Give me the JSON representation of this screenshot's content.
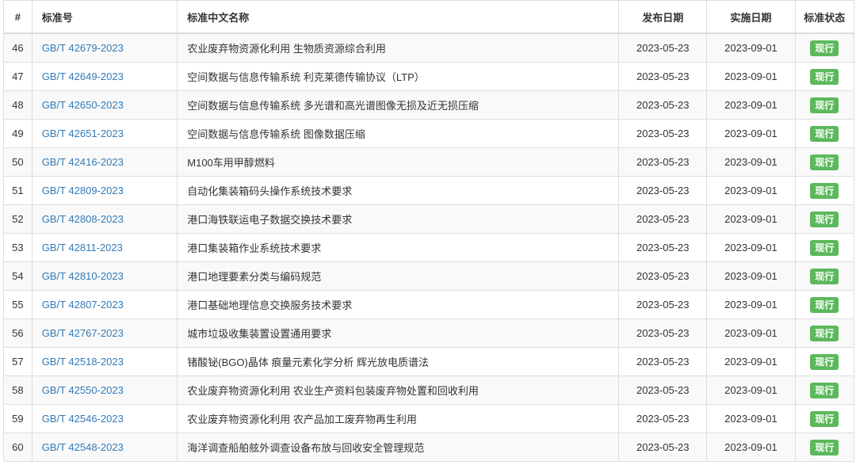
{
  "table": {
    "headers": {
      "num": "#",
      "std_no": "标准号",
      "name": "标准中文名称",
      "publish_date": "发布日期",
      "implement_date": "实施日期",
      "status": "标准状态"
    },
    "rows": [
      {
        "num": "46",
        "std_no": "GB/T 42679-2023",
        "name": "农业废弃物资源化利用 生物质资源综合利用",
        "publish_date": "2023-05-23",
        "implement_date": "2023-09-01",
        "status": "现行"
      },
      {
        "num": "47",
        "std_no": "GB/T 42649-2023",
        "name": "空间数据与信息传输系统 利克莱德传输协议（LTP）",
        "publish_date": "2023-05-23",
        "implement_date": "2023-09-01",
        "status": "现行"
      },
      {
        "num": "48",
        "std_no": "GB/T 42650-2023",
        "name": "空间数据与信息传输系统 多光谱和高光谱图像无损及近无损压缩",
        "publish_date": "2023-05-23",
        "implement_date": "2023-09-01",
        "status": "现行"
      },
      {
        "num": "49",
        "std_no": "GB/T 42651-2023",
        "name": "空间数据与信息传输系统 图像数据压缩",
        "publish_date": "2023-05-23",
        "implement_date": "2023-09-01",
        "status": "现行"
      },
      {
        "num": "50",
        "std_no": "GB/T 42416-2023",
        "name": "M100车用甲醇燃料",
        "publish_date": "2023-05-23",
        "implement_date": "2023-09-01",
        "status": "现行"
      },
      {
        "num": "51",
        "std_no": "GB/T 42809-2023",
        "name": "自动化集装箱码头操作系统技术要求",
        "publish_date": "2023-05-23",
        "implement_date": "2023-09-01",
        "status": "现行"
      },
      {
        "num": "52",
        "std_no": "GB/T 42808-2023",
        "name": "港口海铁联运电子数据交换技术要求",
        "publish_date": "2023-05-23",
        "implement_date": "2023-09-01",
        "status": "现行"
      },
      {
        "num": "53",
        "std_no": "GB/T 42811-2023",
        "name": "港口集装箱作业系统技术要求",
        "publish_date": "2023-05-23",
        "implement_date": "2023-09-01",
        "status": "现行"
      },
      {
        "num": "54",
        "std_no": "GB/T 42810-2023",
        "name": "港口地理要素分类与编码规范",
        "publish_date": "2023-05-23",
        "implement_date": "2023-09-01",
        "status": "现行"
      },
      {
        "num": "55",
        "std_no": "GB/T 42807-2023",
        "name": "港口基础地理信息交换服务技术要求",
        "publish_date": "2023-05-23",
        "implement_date": "2023-09-01",
        "status": "现行"
      },
      {
        "num": "56",
        "std_no": "GB/T 42767-2023",
        "name": "城市垃圾收集装置设置通用要求",
        "publish_date": "2023-05-23",
        "implement_date": "2023-09-01",
        "status": "现行"
      },
      {
        "num": "57",
        "std_no": "GB/T 42518-2023",
        "name": "锗酸铋(BGO)晶体 痕量元素化学分析 辉光放电质谱法",
        "publish_date": "2023-05-23",
        "implement_date": "2023-09-01",
        "status": "现行"
      },
      {
        "num": "58",
        "std_no": "GB/T 42550-2023",
        "name": "农业废弃物资源化利用 农业生产资料包装废弃物处置和回收利用",
        "publish_date": "2023-05-23",
        "implement_date": "2023-09-01",
        "status": "现行"
      },
      {
        "num": "59",
        "std_no": "GB/T 42546-2023",
        "name": "农业废弃物资源化利用 农产品加工废弃物再生利用",
        "publish_date": "2023-05-23",
        "implement_date": "2023-09-01",
        "status": "现行"
      },
      {
        "num": "60",
        "std_no": "GB/T 42548-2023",
        "name": "海洋调查船舶舷外调查设备布放与回收安全管理规范",
        "publish_date": "2023-05-23",
        "implement_date": "2023-09-01",
        "status": "现行"
      }
    ]
  },
  "colors": {
    "link": "#337ab7",
    "status_badge": "#5cb85c",
    "row_stripe": "#f9f9f9",
    "border": "#dddddd"
  }
}
